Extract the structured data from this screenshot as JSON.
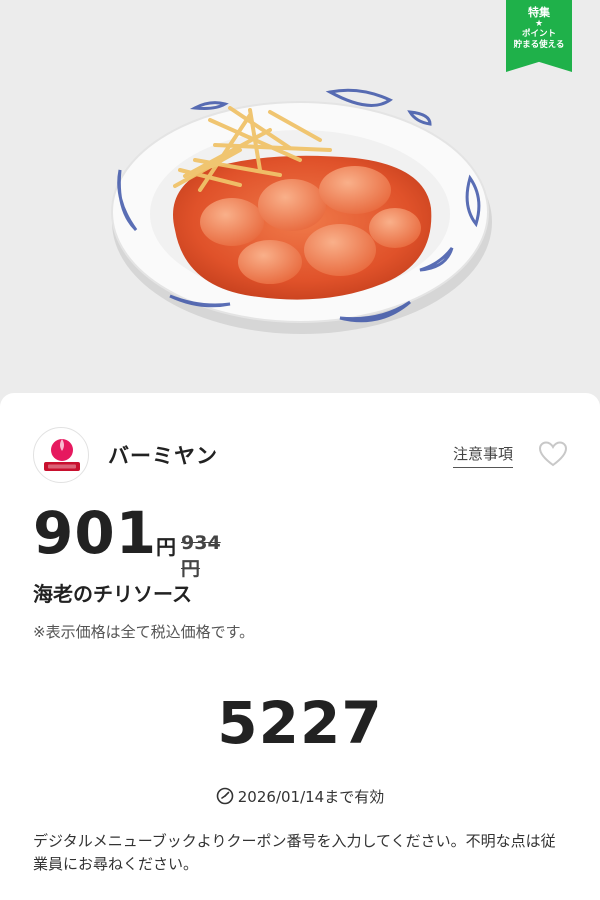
{
  "badge": {
    "title": "特集",
    "star": "★",
    "subtitle": "ポイント\n貯まる使える"
  },
  "hero": {
    "image": "shrimp-chili-sauce-dish-photo"
  },
  "brand": {
    "name": "バーミヤン",
    "logo_text": "バーミヤン"
  },
  "notice_link": "注意事項",
  "favorite": {
    "icon": "heart-outline-icon"
  },
  "price": {
    "current": "901",
    "unit": "円",
    "original": "934円"
  },
  "item_name": "海老のチリソース",
  "tax_note": "※表示価格は全て税込価格です。",
  "coupon_code": "5227",
  "validity": {
    "icon": "clock-icon",
    "text": "2026/01/14まで有効"
  },
  "instructions": "デジタルメニューブックよりクーポン番号を入力してください。不明な点は従業員にお尋ねください。",
  "colors": {
    "badge_green": "#1fb14a",
    "brand_pink": "#e6195f",
    "brand_red": "#c8102e"
  }
}
